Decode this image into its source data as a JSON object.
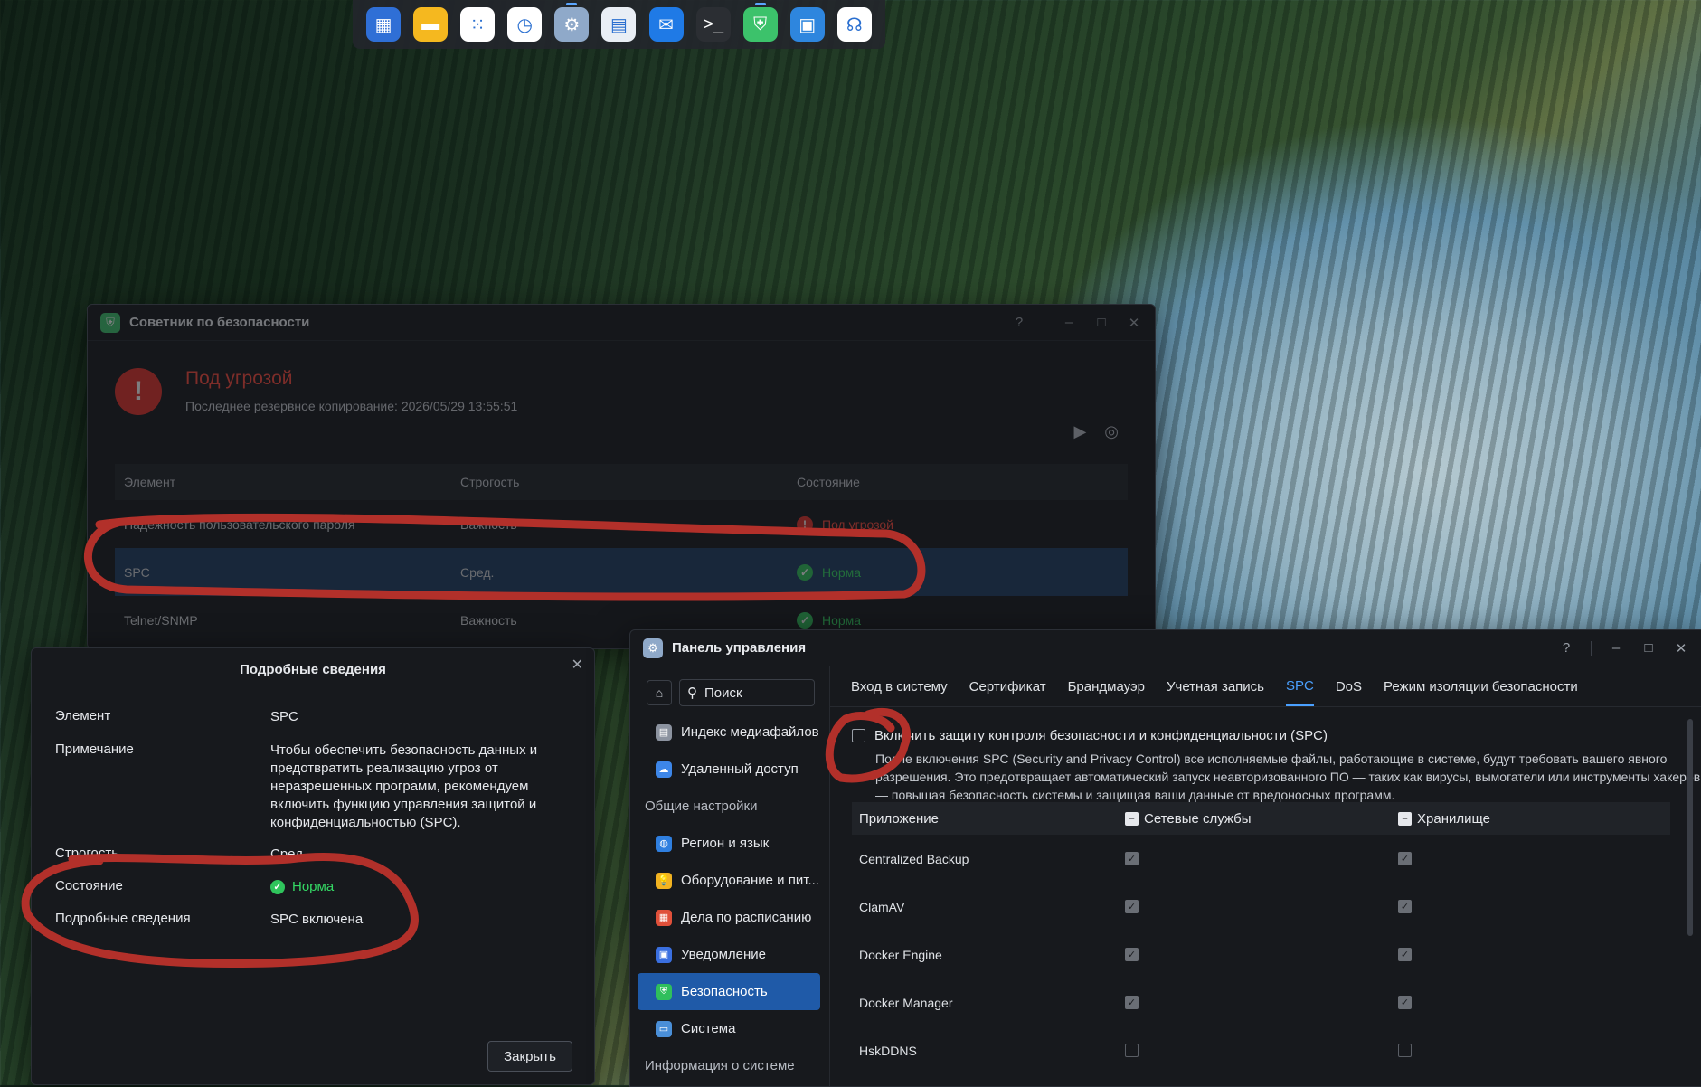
{
  "dock": {
    "apps": [
      {
        "name": "file-manager-icon",
        "bg": "#2f6fd6",
        "glyph": "▦",
        "running": false
      },
      {
        "name": "notes-icon",
        "bg": "#f5b81f",
        "glyph": "▬",
        "running": false
      },
      {
        "name": "app-center-icon",
        "bg": "#ffffff",
        "glyph": "⁙",
        "running": false
      },
      {
        "name": "clock-icon",
        "bg": "#ffffff",
        "glyph": "◷",
        "running": false
      },
      {
        "name": "control-panel-icon",
        "bg": "#8fa9c9",
        "glyph": "⚙",
        "running": true
      },
      {
        "name": "storage-manager-icon",
        "bg": "#e9eef5",
        "glyph": "▤",
        "running": false
      },
      {
        "name": "mail-icon",
        "bg": "#1f7ae6",
        "glyph": "✉",
        "running": false
      },
      {
        "name": "terminal-icon",
        "bg": "#2b2e33",
        "glyph": ">_",
        "running": false
      },
      {
        "name": "security-advisor-icon",
        "bg": "#3cc26b",
        "glyph": "⛨",
        "running": true
      },
      {
        "name": "docker-icon",
        "bg": "#2e86de",
        "glyph": "▣",
        "running": false
      },
      {
        "name": "support-icon",
        "bg": "#ffffff",
        "glyph": "☊",
        "running": false
      }
    ]
  },
  "advisor": {
    "title": "Советник по безопасности",
    "status": "Под угрозой",
    "last_backup": "Последнее резервное копирование: 2026/05/29 13:55:51",
    "columns": [
      "Элемент",
      "Строгость",
      "Состояние"
    ],
    "rows": [
      {
        "item": "Надежность пользовательского пароля",
        "severity": "Важность",
        "state": "Под угрозой",
        "state_kind": "risk"
      },
      {
        "item": "SPC",
        "severity": "Сред.",
        "state": "Норма",
        "state_kind": "ok"
      },
      {
        "item": "Telnet/SNMP",
        "severity": "Важность",
        "state": "Норма",
        "state_kind": "ok"
      }
    ]
  },
  "details": {
    "title": "Подробные сведения",
    "labels": {
      "element": "Элемент",
      "note": "Примечание",
      "severity": "Строгость",
      "state": "Состояние",
      "details": "Подробные сведения"
    },
    "values": {
      "element": "SPC",
      "note": "Чтобы обеспечить безопасность данных и предотвратить реализацию угроз от неразрешенных программ, рекомендуем включить функцию управления защитой и конфиденциальностью (SPC).",
      "severity": "Сред.",
      "state": "Норма",
      "details": "SPC включена"
    },
    "close_label": "Закрыть"
  },
  "control_panel": {
    "title": "Панель управления",
    "search_placeholder": "Поиск",
    "sidebar": [
      {
        "type": "item",
        "label": "Индекс медиафайлов",
        "icon": "media-index-icon",
        "color": "#8c93a0",
        "glyph": "▤"
      },
      {
        "type": "item",
        "label": "Удаленный доступ",
        "icon": "cloud-icon",
        "color": "#3d86e8",
        "glyph": "☁"
      },
      {
        "type": "section",
        "label": "Общие настройки"
      },
      {
        "type": "item",
        "label": "Регион и язык",
        "icon": "globe-icon",
        "color": "#2f7fe0",
        "glyph": "◍"
      },
      {
        "type": "item",
        "label": "Оборудование и пит...",
        "icon": "bulb-icon",
        "color": "#f2b321",
        "glyph": "💡"
      },
      {
        "type": "item",
        "label": "Дела по расписанию",
        "icon": "calendar-icon",
        "color": "#e0503a",
        "glyph": "▦"
      },
      {
        "type": "item",
        "label": "Уведомление",
        "icon": "notification-icon",
        "color": "#3a6fe0",
        "glyph": "▣"
      },
      {
        "type": "item",
        "label": "Безопасность",
        "icon": "shield-icon",
        "color": "#2fbf5c",
        "glyph": "⛨",
        "active": true
      },
      {
        "type": "item",
        "label": "Система",
        "icon": "system-icon",
        "color": "#4a8fd8",
        "glyph": "▭"
      },
      {
        "type": "section",
        "label": "Информация о системе"
      }
    ],
    "tabs": [
      "Вход в систему",
      "Сертификат",
      "Брандмауэр",
      "Учетная запись",
      "SPC",
      "DoS",
      "Режим изоляции безопасности"
    ],
    "active_tab": "SPC",
    "spc_enable_label": "Включить защиту контроля безопасности и конфиденциальности (SPC)",
    "spc_enabled": false,
    "spc_description": "После включения SPC (Security and Privacy Control) все исполняемые файлы, работающие в системе, будут требовать вашего явного разрешения. Это предотвращает автоматический запуск неавторизованного ПО — таких как вирусы, вымогатели или инструменты хакеров — повышая безопасность системы и защищая ваши данные от вредоносных программ.",
    "app_columns": [
      "Приложение",
      "Сетевые службы",
      "Хранилище"
    ],
    "apps": [
      {
        "name": "Centralized Backup",
        "network": true,
        "storage": true
      },
      {
        "name": "ClamAV",
        "network": true,
        "storage": true
      },
      {
        "name": "Docker Engine",
        "network": true,
        "storage": true
      },
      {
        "name": "Docker Manager",
        "network": true,
        "storage": true
      },
      {
        "name": "HskDDNS",
        "network": false,
        "storage": false
      }
    ]
  },
  "annotation_color": "#b2302a"
}
